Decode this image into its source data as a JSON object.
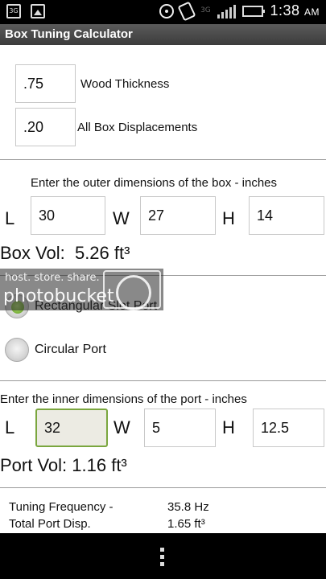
{
  "status_bar": {
    "time": "1:38",
    "ampm": "AM",
    "network": "3G",
    "icons": [
      "sd-card-icon",
      "picture-icon",
      "gps-icon",
      "vibrate-icon",
      "signal-icon",
      "battery-icon"
    ]
  },
  "app": {
    "title": "Box Tuning Calculator"
  },
  "settings": {
    "wood_thickness": {
      "value": ".75",
      "label": "Wood Thickness"
    },
    "box_displacements": {
      "value": ".20",
      "label": "All Box Displacements"
    }
  },
  "box": {
    "instruction": "Enter the outer dimensions of the box - inches",
    "L": {
      "label": "L",
      "value": "30"
    },
    "W": {
      "label": "W",
      "value": "27"
    },
    "H": {
      "label": "H",
      "value": "14"
    },
    "volume_label": "Box Vol:",
    "volume_value": "5.26 ft³"
  },
  "watermark": {
    "line1": "host. store. share.",
    "line2": "photobucket"
  },
  "port_type": {
    "options": [
      {
        "label": "Rectangular Slot Port",
        "checked": true
      },
      {
        "label": "Circular Port",
        "checked": false
      }
    ]
  },
  "port": {
    "instruction": "Enter the inner dimensions of the port - inches",
    "L": {
      "label": "L",
      "value": "32"
    },
    "W": {
      "label": "W",
      "value": "5"
    },
    "H": {
      "label": "H",
      "value": "12.5"
    },
    "volume_label": "Port Vol:",
    "volume_value": "1.16 ft³"
  },
  "results": [
    {
      "label": "Tuning Frequency -",
      "value": "35.8 Hz"
    },
    {
      "label": "Total Port Disp.",
      "value": "1.65 ft³"
    }
  ],
  "colors": {
    "focus_border": "#7aa63e",
    "radio_checked": "#5c9a1e",
    "titlebar": "#4a4a4a"
  }
}
